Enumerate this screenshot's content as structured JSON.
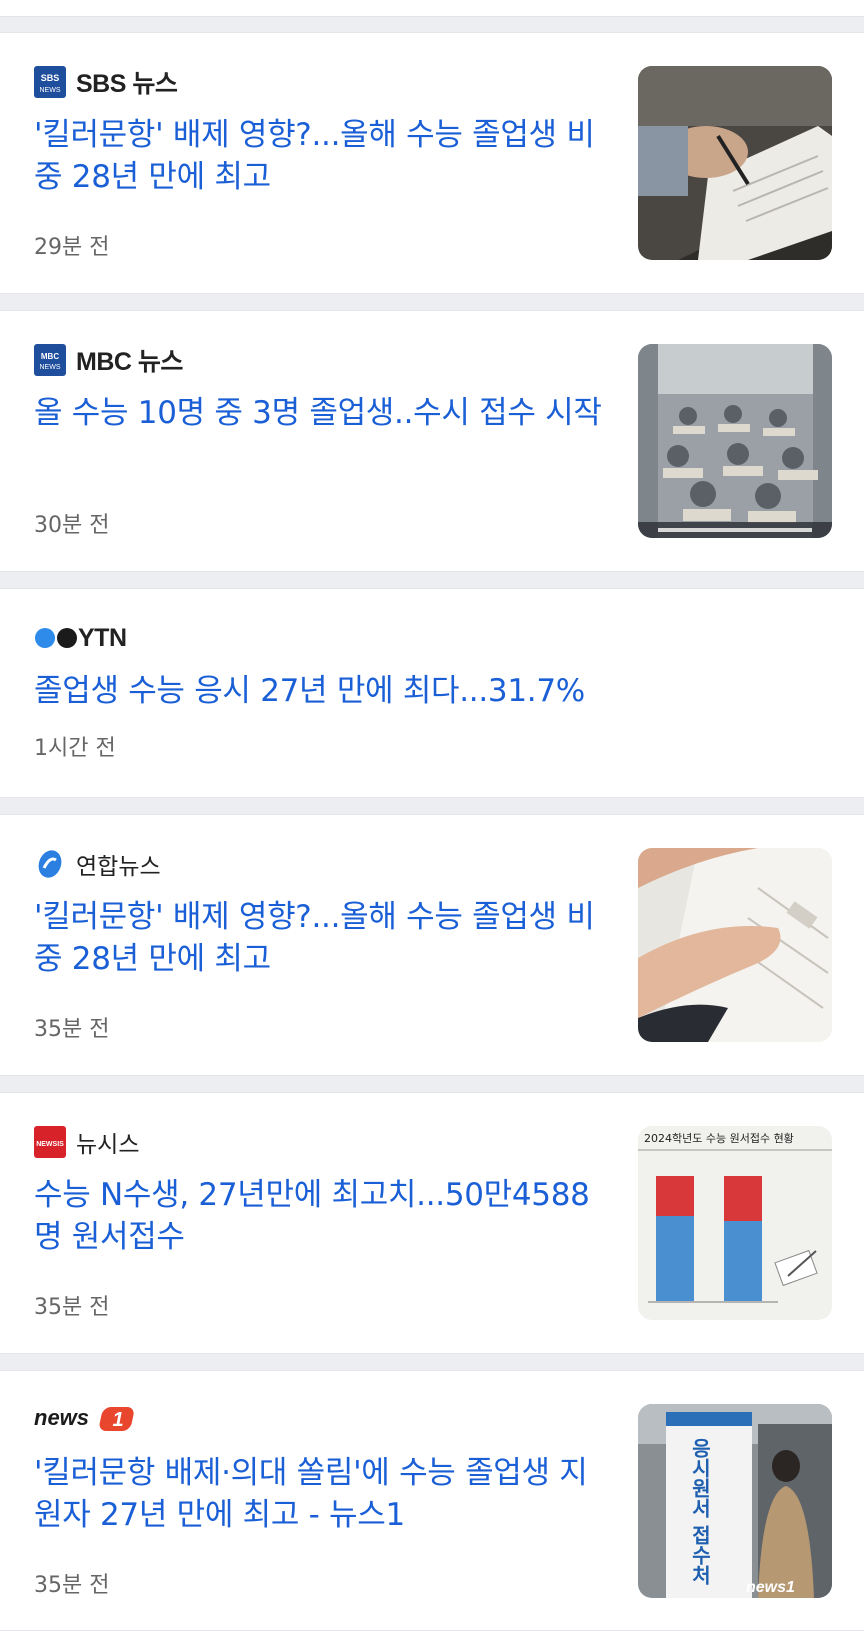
{
  "articles": [
    {
      "publisher": "SBS 뉴스",
      "logo_text": "SBS NEWS",
      "headline": "'킬러문항' 배제 영향?...올해 수능 졸업생 비중 28년 만에 최고",
      "time": "29분 전",
      "thumbnail": "student-writing-exam-photo"
    },
    {
      "publisher": "MBC 뉴스",
      "logo_text": "MBC",
      "headline": "올 수능 10명 중 3명 졸업생..수시 접수 시작",
      "time": "30분 전",
      "thumbnail": "exam-classroom-photo"
    },
    {
      "publisher": "YTN",
      "headline": "졸업생 수능 응시 27년 만에 최다...31.7%",
      "time": "1시간 전"
    },
    {
      "publisher": "연합뉴스",
      "headline": "'킬러문항' 배제 영향?...올해 수능 졸업생 비중 28년 만에 최고",
      "time": "35분 전",
      "thumbnail": "hands-on-exam-paper-photo"
    },
    {
      "publisher": "뉴시스",
      "logo_text": "NEWSIS",
      "headline": "수능 N수생, 27년만에 최고치...50만4588명 원서접수",
      "time": "35분 전",
      "thumbnail": "application-statistics-infographic",
      "thumb_title": "2024학년도 수능 원서접수 현황"
    },
    {
      "publisher": "news1",
      "logo_text": "news",
      "headline": "'킬러문항 배제·의대 쏠림'에 수능 졸업생 지원자 27년 만에 최고 - 뉴스1",
      "time": "35분 전",
      "thumbnail": "application-desk-photo",
      "thumb_sign": "응시원서 접수처",
      "thumb_watermark": "news1"
    }
  ],
  "colors": {
    "headline": "#1a5fd6",
    "time": "#666666",
    "divider": "#eceef1"
  }
}
